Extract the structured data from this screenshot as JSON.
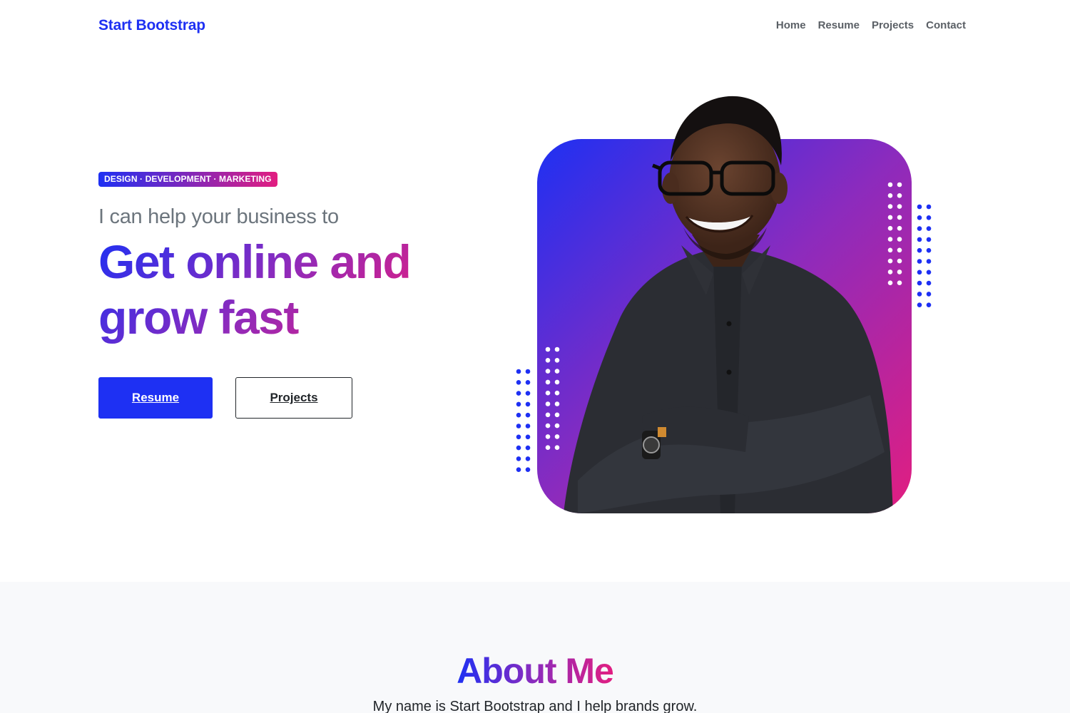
{
  "nav": {
    "brand": "Start Bootstrap",
    "links": [
      {
        "label": "Home"
      },
      {
        "label": "Resume"
      },
      {
        "label": "Projects"
      },
      {
        "label": "Contact"
      }
    ]
  },
  "hero": {
    "badge": "DESIGN · DEVELOPMENT · MARKETING",
    "lead": "I can help your business to",
    "title": "Get online and grow fast",
    "primary_button": "Resume",
    "secondary_button": "Projects"
  },
  "about": {
    "title": "About Me",
    "text": "My name is Start Bootstrap and I help brands grow."
  },
  "colors": {
    "primary": "#1e30f3",
    "secondary": "#e21e80",
    "muted": "#6c757d",
    "section_bg": "#f8f9fb"
  }
}
